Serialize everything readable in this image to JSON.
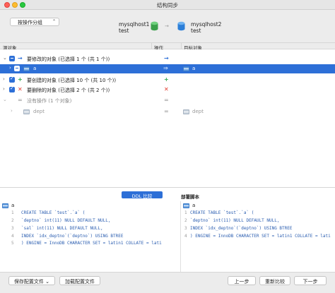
{
  "window": {
    "title": "结构同步"
  },
  "header": {
    "group_select": "按操作分组",
    "source": {
      "host": "mysqlhost1",
      "db": "test"
    },
    "target": {
      "host": "mysqlhost2",
      "db": "test"
    }
  },
  "columns": {
    "source": "源对象",
    "op": "操作",
    "target": "目标对象"
  },
  "rows": [
    {
      "label": "要修改的对象 (已选择 1 个 (共 1 个))",
      "op": "→"
    },
    {
      "label": "a",
      "target": "a",
      "op": "⇒"
    },
    {
      "label": "要创建的对象 (已选择 10 个 (共 10 个))",
      "op": "+"
    },
    {
      "label": "要删除的对象 (已选择 2 个 (共 2 个))",
      "op": "✕"
    },
    {
      "label": "没有操作 (1 个对象)",
      "op": "="
    },
    {
      "label": "dept",
      "target": "dept",
      "op": "="
    }
  ],
  "bottom": {
    "ddl_tab": "DDL 比较",
    "deploy_label": "部署脚本",
    "left_table": "a",
    "right_table": "a",
    "left_code": [
      "CREATE TABLE `test`.`a`  (",
      "  `deptno` int(11) NULL DEFAULT NULL,",
      "  `sal` int(11) NULL DEFAULT NULL,",
      "  INDEX `idx_deptno`(`deptno`) USING BTREE",
      ") ENGINE = InnoDB CHARACTER SET = latin1 COLLATE = lati"
    ],
    "right_code": [
      "CREATE TABLE `test`.`a`  (",
      "  `deptno` int(11) NULL DEFAULT NULL,",
      "  INDEX `idx_deptno`(`deptno`) USING BTREE",
      ") ENGINE = InnoDB CHARACTER SET = latin1 COLLATE = lati"
    ],
    "right_line_numbers": [
      "1",
      "2",
      "",
      "3",
      "4"
    ]
  },
  "footer": {
    "save_config": "保存配置文件",
    "load_config": "加载配置文件",
    "prev": "上一步",
    "recompare": "重新比较",
    "next": "下一步"
  },
  "colors": {
    "accent": "#2d6fd7",
    "add": "#2fa84f",
    "delete": "#e23b2e"
  }
}
